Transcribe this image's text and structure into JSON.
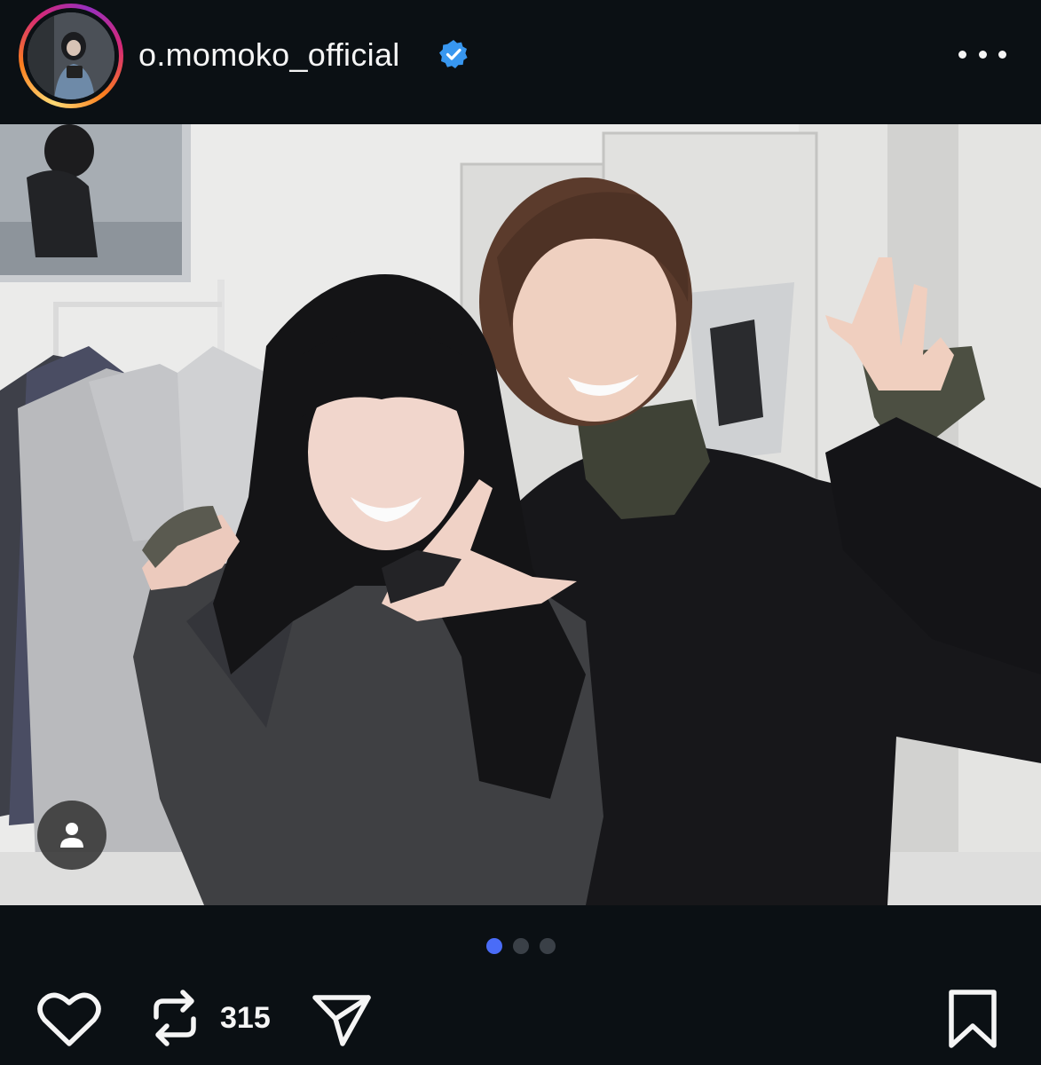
{
  "post": {
    "username": "o.momoko_official",
    "verified": true,
    "avatar": "profile-photo",
    "more_icon": "more-horizontal-icon"
  },
  "media": {
    "description_icon": "photo",
    "current_slide": 1,
    "total_slides": 3,
    "tag_icon": "user-tag-icon"
  },
  "actions": {
    "like_icon": "heart-icon",
    "repost_icon": "repost-icon",
    "repost_count": "315",
    "share_icon": "send-icon",
    "save_icon": "bookmark-icon"
  },
  "colors": {
    "background": "#0b1014",
    "accent_dot": "#4a6cf7",
    "verified": "#3897f0"
  }
}
